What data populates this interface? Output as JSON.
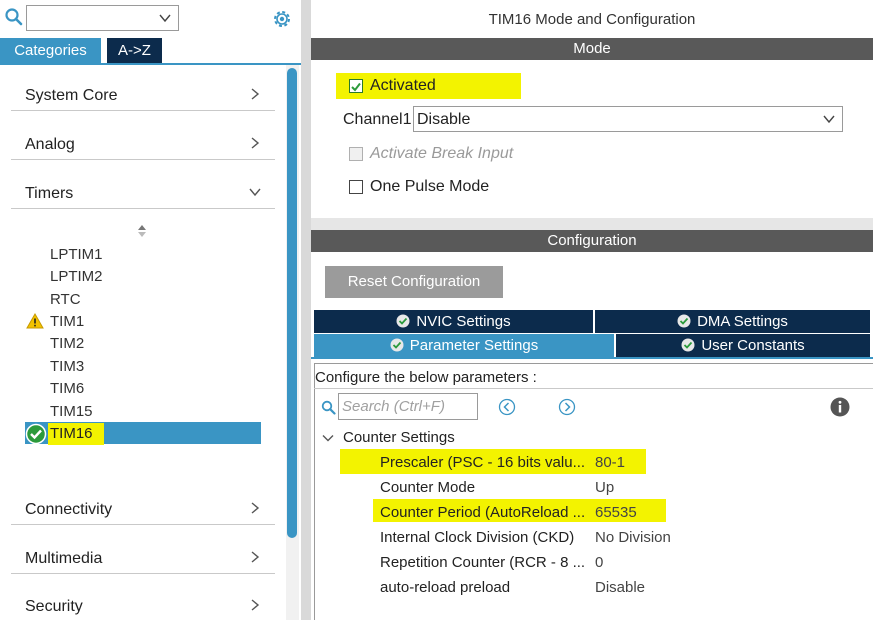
{
  "left": {
    "tabs": {
      "categories": "Categories",
      "az": "A->Z"
    },
    "search": {
      "value": ""
    },
    "categories": [
      {
        "label": "System Core",
        "expanded": false
      },
      {
        "label": "Analog",
        "expanded": false
      },
      {
        "label": "Timers",
        "expanded": true
      },
      {
        "label": "Connectivity",
        "expanded": false
      },
      {
        "label": "Multimedia",
        "expanded": false
      },
      {
        "label": "Security",
        "expanded": false
      }
    ],
    "timers": [
      "LPTIM1",
      "LPTIM2",
      "RTC",
      "TIM1",
      "TIM2",
      "TIM3",
      "TIM6",
      "TIM15",
      "TIM16"
    ],
    "selected_timer": "TIM16"
  },
  "right": {
    "title": "TIM16 Mode and Configuration",
    "mode_header": "Mode",
    "activated": {
      "label": "Activated",
      "checked": true
    },
    "channel1": {
      "label": "Channel1",
      "value": "Disable"
    },
    "break_input": {
      "label": "Activate Break Input",
      "checked": false,
      "disabled": true
    },
    "one_pulse": {
      "label": "One Pulse Mode",
      "checked": false
    },
    "config_header": "Configuration",
    "reset_button": "Reset Configuration",
    "tabs": [
      {
        "label": "NVIC Settings",
        "active": false
      },
      {
        "label": "DMA Settings",
        "active": false
      },
      {
        "label": "Parameter Settings",
        "active": true
      },
      {
        "label": "User Constants",
        "active": false
      }
    ],
    "param_header": "Configure the below parameters :",
    "search_placeholder": "Search (Ctrl+F)",
    "group": "Counter Settings",
    "params": [
      {
        "name": "Prescaler (PSC - 16 bits valu...",
        "value": "80-1",
        "highlight": true
      },
      {
        "name": "Counter Mode",
        "value": "Up",
        "highlight": false
      },
      {
        "name": "Counter Period (AutoReload ...",
        "value": "65535",
        "highlight": true
      },
      {
        "name": "Internal Clock Division (CKD)",
        "value": "No Division",
        "highlight": false
      },
      {
        "name": "Repetition Counter (RCR - 8 ...",
        "value": "0",
        "highlight": false
      },
      {
        "name": "auto-reload preload",
        "value": "Disable",
        "highlight": false
      }
    ]
  },
  "colors": {
    "accent": "#3a95c4",
    "dark_tab": "#0c2b4c",
    "header_bar": "#595959",
    "highlight": "#f3f300",
    "check_green": "#2b9a3b"
  }
}
